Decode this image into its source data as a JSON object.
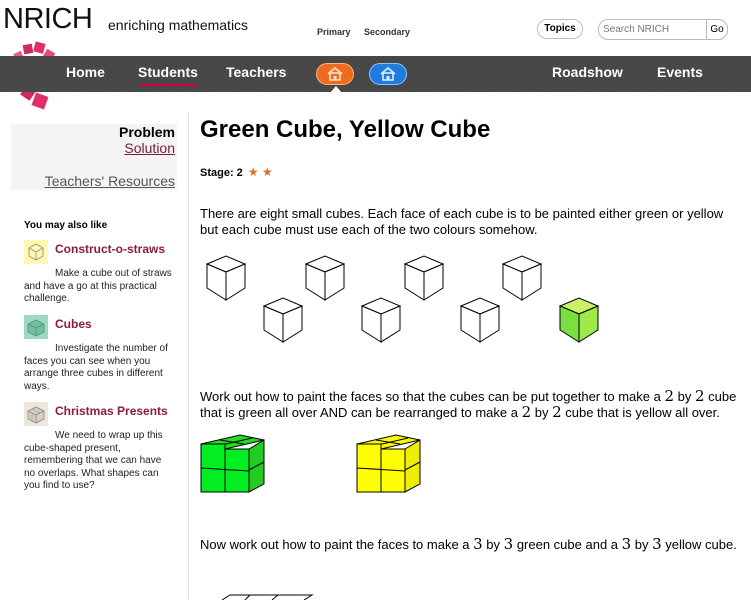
{
  "header": {
    "logo_text": "NRICH",
    "logo_subtitle": "enriching mathematics",
    "label_primary": "Primary",
    "label_secondary": "Secondary",
    "topics_label": "Topics",
    "search_placeholder": "Search NRICH",
    "go_label": "Go"
  },
  "nav": {
    "home": "Home",
    "students": "Students",
    "teachers": "Teachers",
    "roadshow": "Roadshow",
    "events": "Events",
    "primary_home_icon": "house-icon",
    "secondary_home_icon": "house-icon"
  },
  "sidebar": {
    "tab_current": "Problem",
    "tab_solution": "Solution",
    "tab_teachers": "Teachers' Resources",
    "also_like_heading": "You may also like",
    "items": [
      {
        "title": "Construct-o-straws",
        "desc": "Make a cube out of straws and have a go at this practical challenge."
      },
      {
        "title": "Cubes",
        "desc": "Investigate the number of faces you can see when you arrange three cubes in different ways."
      },
      {
        "title": "Christmas Presents",
        "desc": "We need to wrap up this cube-shaped present, remembering that we can have no overlaps. What shapes can you find to use?"
      }
    ]
  },
  "main": {
    "title": "Green Cube, Yellow Cube",
    "stage_label": "Stage: 2",
    "stars": "★ ★",
    "para1": "There are eight small cubes. Each face of each cube is to be painted either green or yellow but each cube must use each of the two colours somehow.",
    "para2_a": "Work out how to paint the faces so that the cubes can be put together to make a ",
    "para2_b": "2",
    "para2_c": " by ",
    "para2_d": "2",
    "para2_e": " cube that is green all over AND can be rearranged to make a ",
    "para2_f": "2",
    "para2_g": " by ",
    "para2_h": "2",
    "para2_i": " cube that is yellow all over.",
    "para3_a": "Now work out how to paint the faces to make a ",
    "para3_b": "3",
    "para3_c": " by ",
    "para3_d": "3",
    "para3_e": " green cube and a ",
    "para3_f": "3",
    "para3_g": " by ",
    "para3_h": "3",
    "para3_i": " yellow cube."
  },
  "colors": {
    "accent_red": "#d3003f",
    "link_maroon": "#8b1a44",
    "green_cube": "#22e022",
    "yellow_cube": "#f5f500",
    "small_green_cube": "#88ee44"
  }
}
